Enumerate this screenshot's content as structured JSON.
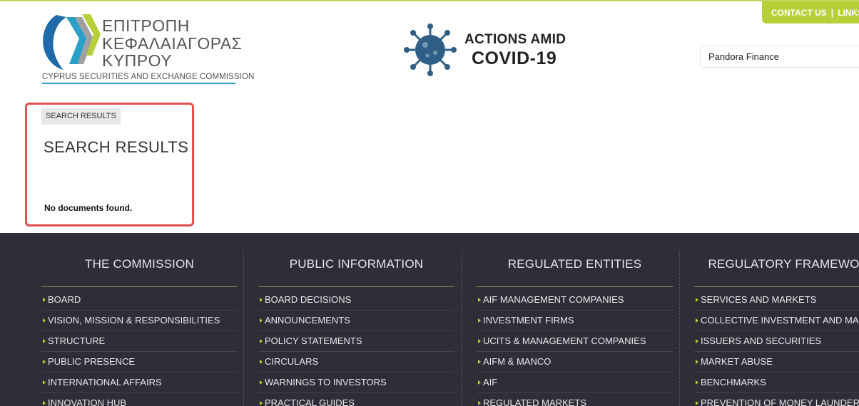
{
  "header": {
    "top_links": [
      "CONTACT US",
      "LINKS"
    ],
    "top_links_sep": "|",
    "logo": {
      "line1": "ΕΠΙΤΡΟΠΗ",
      "line2": "ΚΕΦΑΛΑΙΑΓΟΡΑΣ",
      "line3": "ΚΥΠΡΟΥ",
      "subtitle": "CYPRUS SECURITIES AND EXCHANGE COMMISSION"
    },
    "covid": {
      "line1": "ACTIONS AMID",
      "line2": "COVID-19",
      "color": "#2f5f86"
    },
    "search_value": "Pandora Finance"
  },
  "main": {
    "breadcrumb": "SEARCH RESULTS",
    "title": "SEARCH RESULTS",
    "message": "No documents found."
  },
  "colors": {
    "accent": "#b9cf39",
    "footer_bg": "#2d2e38",
    "highlight": "#e5504c",
    "logo_blue": "#2aa0c9"
  },
  "footer": {
    "columns": [
      {
        "title": "THE COMMISSION",
        "items": [
          "BOARD",
          "VISION, MISSION & RESPONSIBILITIES",
          "STRUCTURE",
          "PUBLIC PRESENCE",
          "INTERNATIONAL AFFAIRS",
          "INNOVATION HUB"
        ]
      },
      {
        "title": "PUBLIC INFORMATION",
        "items": [
          "BOARD DECISIONS",
          "ANNOUNCEMENTS",
          "POLICY STATEMENTS",
          "CIRCULARS",
          "WARNINGS TO INVESTORS",
          "PRACTICAL GUIDES"
        ]
      },
      {
        "title": "REGULATED ENTITIES",
        "items": [
          "AIF MANAGEMENT COMPANIES",
          "INVESTMENT FIRMS",
          "UCITS & MANAGEMENT COMPANIES",
          "AIFM & MANCO",
          "AIF",
          "REGULATED MARKETS"
        ]
      },
      {
        "title": "REGULATORY FRAMEWORK",
        "items": [
          "SERVICES AND MARKETS",
          "COLLECTIVE INVESTMENT AND MANAGEMENT",
          "ISSUERS AND SECURITIES",
          "MARKET ABUSE",
          "BENCHMARKS",
          "PREVENTION OF MONEY LAUNDERING"
        ]
      }
    ]
  }
}
